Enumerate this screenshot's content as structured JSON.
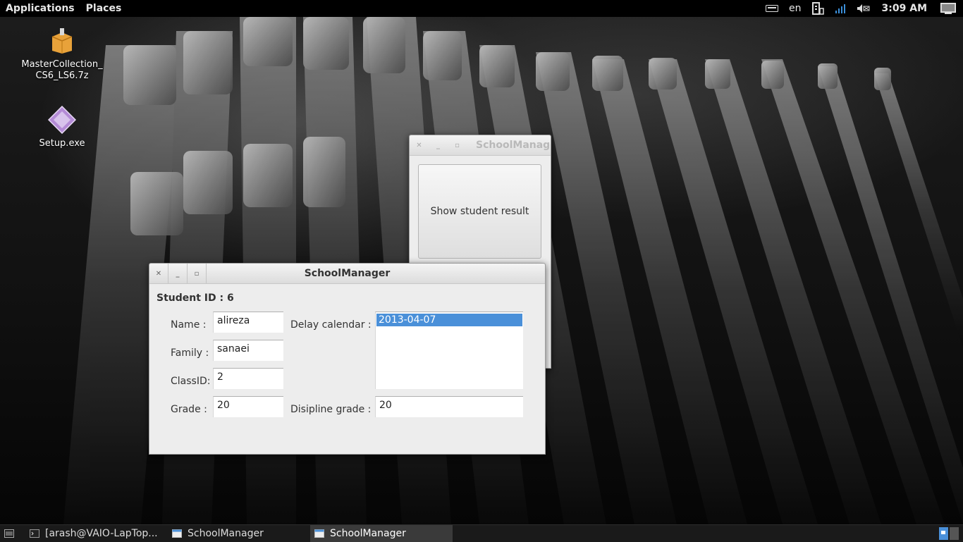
{
  "top_panel": {
    "menus": [
      "Applications",
      "Places"
    ],
    "language": "en",
    "clock": "3:09 AM",
    "tray_icons": [
      "keyboard-icon",
      "network-manager-icon",
      "signal-bars-icon",
      "volume-icon",
      "desktop-icon"
    ]
  },
  "desktop": {
    "icons": [
      {
        "label_line1": "MasterCollection_",
        "label_line2": "CS6_LS6.7z",
        "icon": "archive-box-icon"
      },
      {
        "label": "Setup.exe",
        "icon": "installer-diamond-icon"
      }
    ]
  },
  "back_window": {
    "title": "SchoolManager",
    "show_result_button": "Show student result"
  },
  "front_window": {
    "title": "SchoolManager",
    "student_id_label": "Student ID : 6",
    "name_label": "Name  :",
    "name_value": "alireza",
    "family_label": "Family :",
    "family_value": "sanaei",
    "classid_label": "ClassID:",
    "classid_value": "2",
    "grade_label": "Grade :",
    "grade_value": "20",
    "delay_calendar_label": "Delay calendar  :",
    "delay_dates": [
      "2013-04-07"
    ],
    "discipline_label": "Disipline grade :",
    "discipline_value": "20"
  },
  "taskbar": {
    "tasks": [
      {
        "label": "[arash@VAIO-LapTop...",
        "active": false
      },
      {
        "label": "SchoolManager",
        "active": false
      },
      {
        "label": "SchoolManager",
        "active": true
      }
    ]
  },
  "colors": {
    "selection": "#4a90d9",
    "panel_bg": "#000000",
    "window_bg": "#ededed"
  }
}
